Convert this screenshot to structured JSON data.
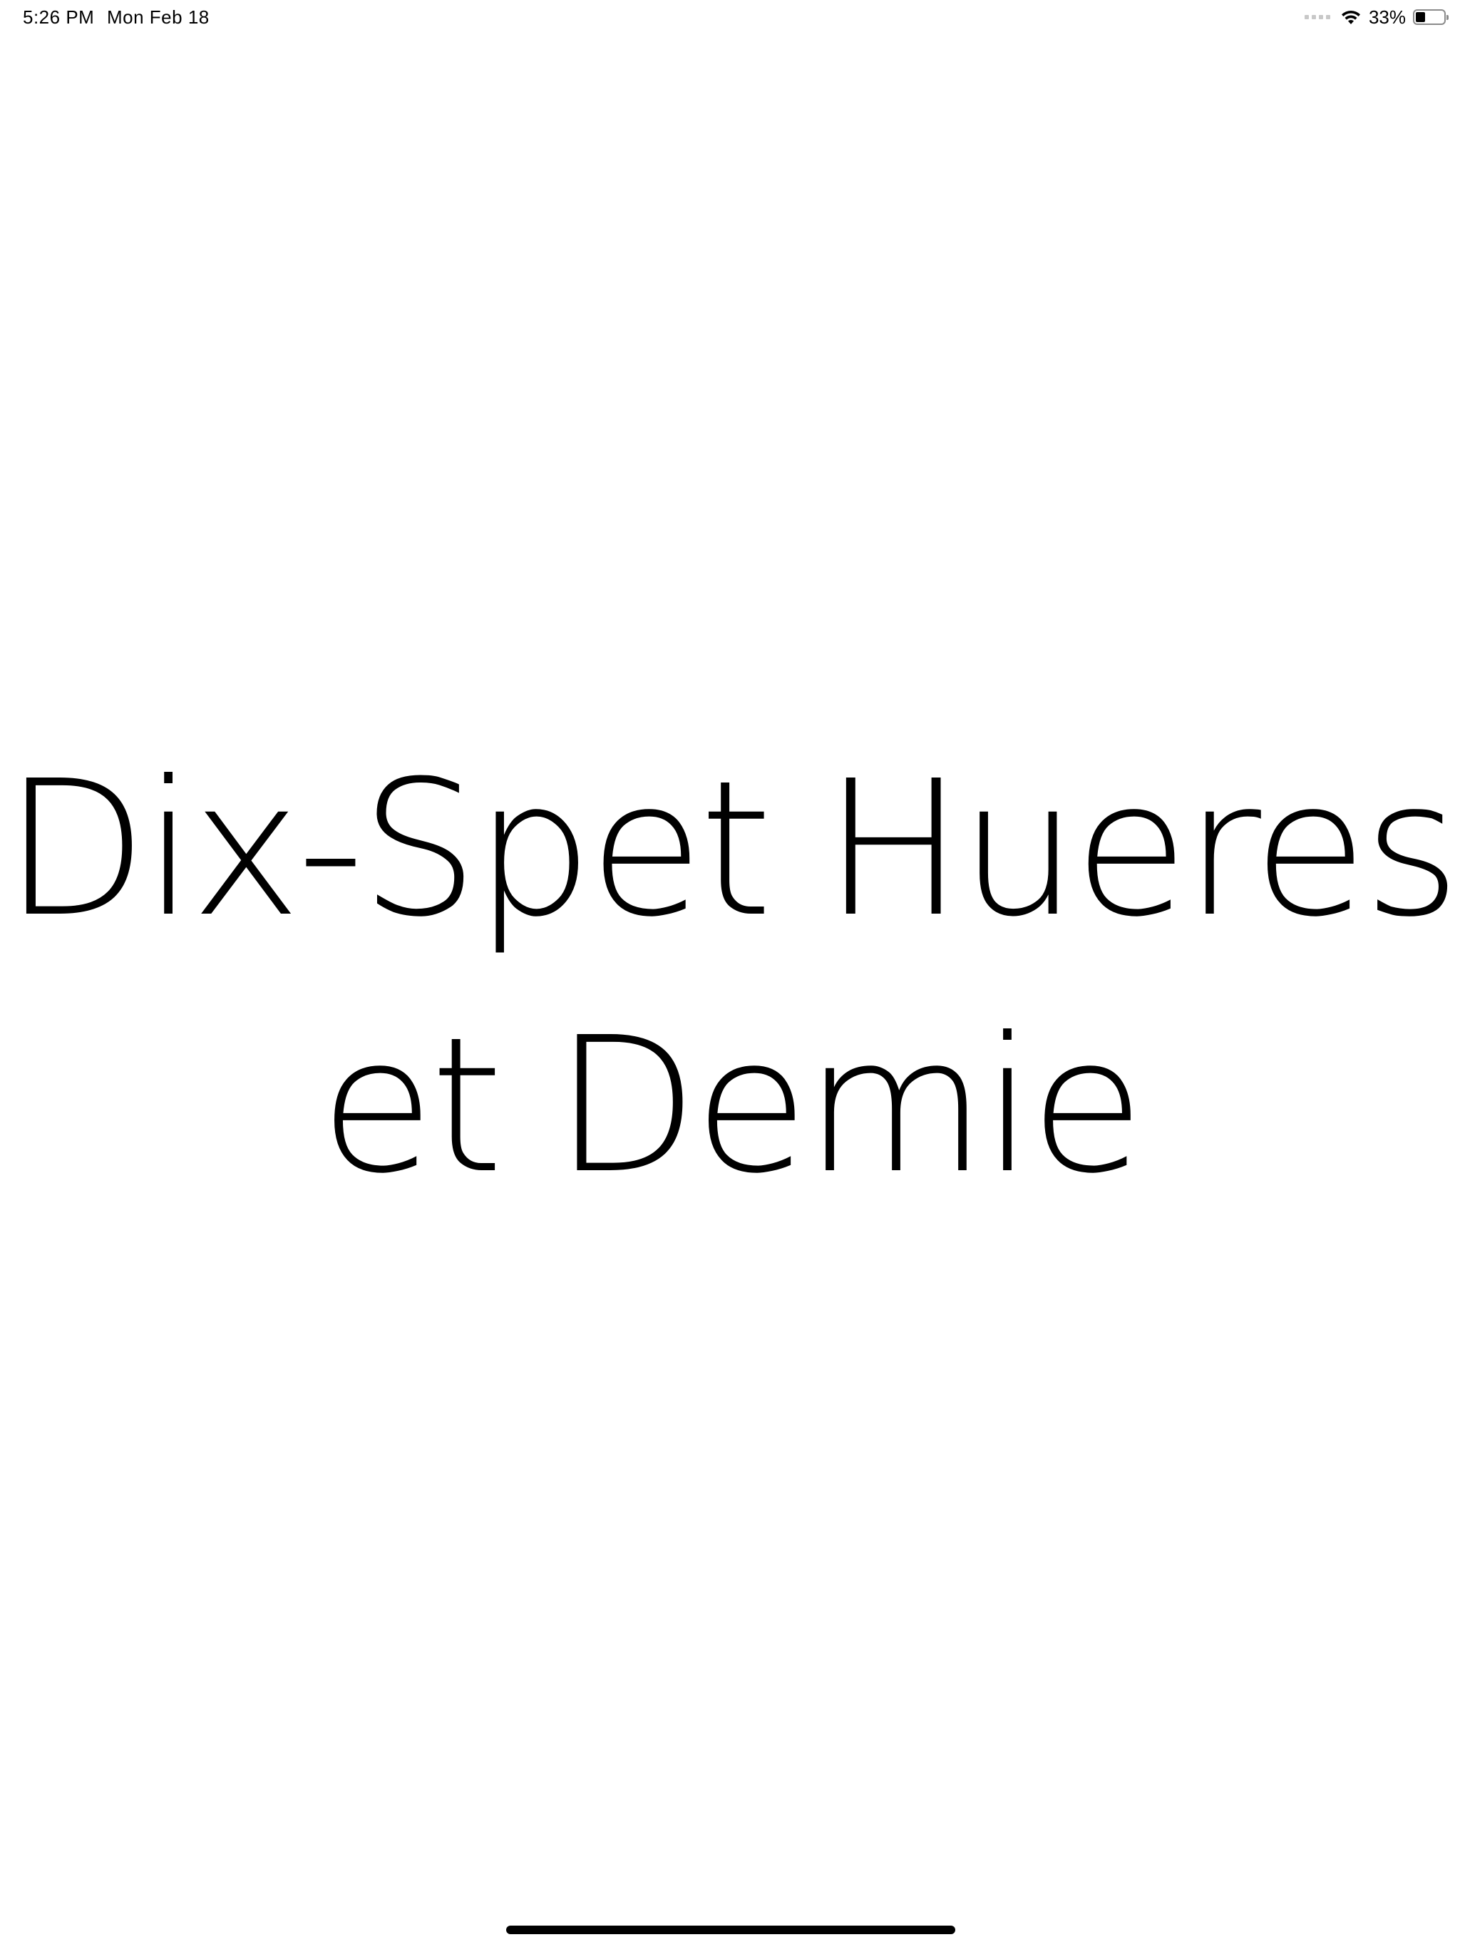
{
  "status_bar": {
    "time": "5:26 PM",
    "date": "Mon Feb 18",
    "battery_percent": "33%",
    "battery_level": 0.33,
    "wifi_icon": "wifi-icon",
    "battery_icon": "battery-icon"
  },
  "main": {
    "line1": "Dix-Spet Hueres",
    "line2": "et Demie"
  }
}
